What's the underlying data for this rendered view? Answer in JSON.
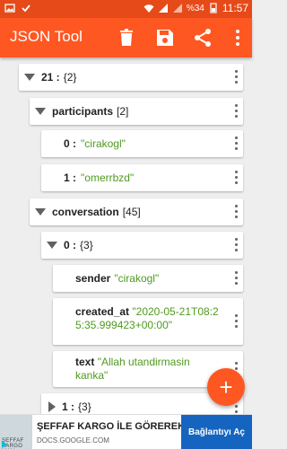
{
  "status_bar": {
    "time": "11:57",
    "battery": "%34",
    "icons": [
      "image-icon",
      "check-icon",
      "wifi-icon",
      "signal-icon",
      "signal-icon",
      "battery-icon"
    ]
  },
  "app_bar": {
    "title": "JSON Tool",
    "actions": [
      "delete-icon",
      "save-icon",
      "share-icon",
      "more-vert-icon"
    ]
  },
  "tree": {
    "root": {
      "key": "21 :",
      "meta": "{2}"
    },
    "participants": {
      "key": "participants",
      "meta": "[2]"
    },
    "p0": {
      "key": "0 :",
      "value": "\"cirakogl\""
    },
    "p1": {
      "key": "1 :",
      "value": "\"omerrbzd\""
    },
    "conversation": {
      "key": "conversation",
      "meta": "[45]"
    },
    "c0": {
      "key": "0 :",
      "meta": "{3}"
    },
    "sender": {
      "key": "sender",
      "value": "\"cirakogl\""
    },
    "created_at": {
      "key": "created_at",
      "value": "\"2020-05-21T08:25:35.999423+00:00\""
    },
    "text": {
      "key": "text",
      "value": "\"Allah utandirmasin kanka\""
    },
    "c1": {
      "key": "1 :",
      "meta": "{3}"
    }
  },
  "fab": {
    "label": "+"
  },
  "ad": {
    "thumb_text": "ŞEFFAF KARGO MAN",
    "title": "ŞEFFAF KARGO İLE GÖREREK...",
    "url": "DOCS.GOOGLE.COM",
    "cta": "Bağlantıyı Aç"
  },
  "colors": {
    "accent": "#ff5722",
    "status_bar": "#e64a19",
    "string_value": "#4f9a1f",
    "ad_button": "#1565c0"
  }
}
